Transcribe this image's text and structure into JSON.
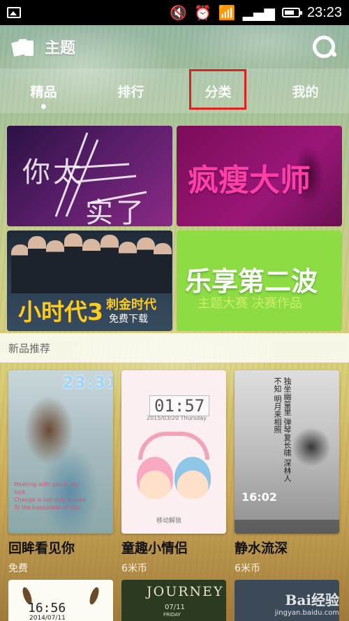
{
  "status_bar": {
    "time": "23:23",
    "battery_level": 0.75,
    "icons": [
      "image-icon",
      "mute-icon",
      "alarm-icon",
      "wifi-icon",
      "signal-icon",
      "battery-icon"
    ]
  },
  "app_bar": {
    "title": "主题",
    "logo_icon": "theme-logo-icon",
    "search_icon": "search-icon"
  },
  "tabs": [
    {
      "label": "精品",
      "active": true
    },
    {
      "label": "排行",
      "active": false
    },
    {
      "label": "分类",
      "active": false,
      "highlighted": true
    },
    {
      "label": "我的",
      "active": false
    }
  ],
  "banners": {
    "b1": {
      "line1": "你太",
      "line2": "实了"
    },
    "b2": {
      "text": "疯瘦大师"
    },
    "b3": {
      "title": "小时代3",
      "sub1": "刺金时代",
      "sub2": "免费下载"
    },
    "b4": {
      "text": "乐享第二波",
      "sub": "主题大赛 决赛作品"
    }
  },
  "section": {
    "title": "新品推荐"
  },
  "cards": [
    {
      "title": "回眸看见你",
      "price": "免费",
      "thumb_time": "23:31",
      "thumb_lines": [
        "Meeting with you is my luck",
        "Change is not only a road",
        "To the happiness of you"
      ]
    },
    {
      "title": "童趣小情侣",
      "price": "6米币",
      "thumb_time": "01:57",
      "thumb_date": "2015/03/20  Thursday",
      "thumb_unlock": "移动解锁"
    },
    {
      "title": "静水流深",
      "price": "6米币",
      "thumb_time": "16:02",
      "thumb_poem": "独坐幽篁里 弹琴复长啸 深林人不知 明月来相照"
    }
  ],
  "bottom_cards": [
    {
      "time": "16:56",
      "date": "2014/07/11"
    },
    {
      "title": "JOURNEY",
      "date": "07/11",
      "day": "FRIDAY"
    },
    {}
  ],
  "watermark": {
    "main": "Bai经验",
    "sub": "jingyan.baidu.com"
  },
  "colors": {
    "highlight_box": "#e0201c",
    "banner_b3_text": "#ffcc1a",
    "banner_b2_text": "#ff3fa8",
    "banner_b4_bg": "#8edc44"
  }
}
